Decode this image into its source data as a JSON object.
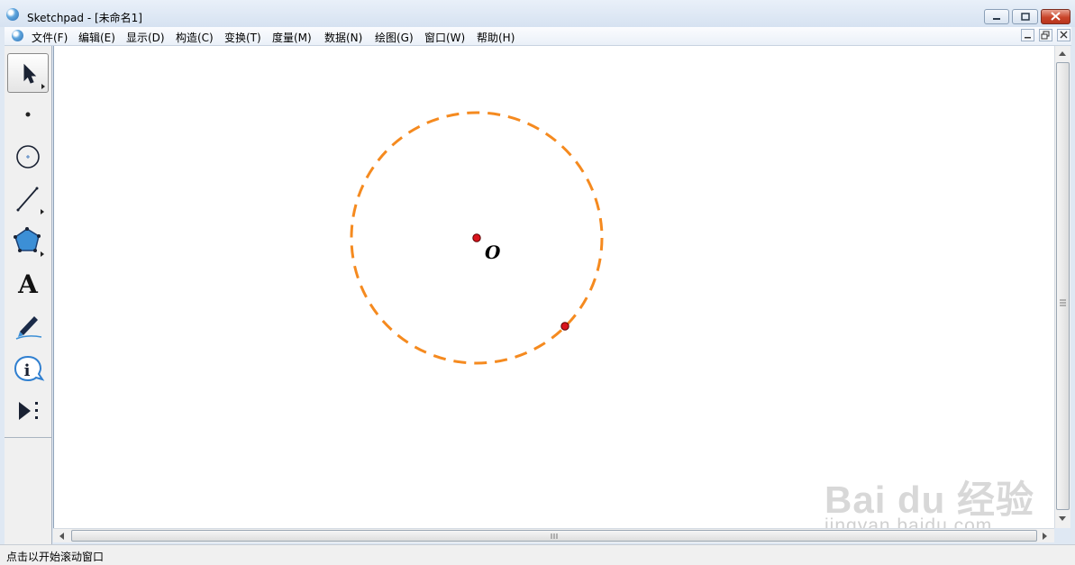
{
  "window": {
    "title": "Sketchpad  - [未命名1]"
  },
  "menu": {
    "items": [
      {
        "label": "文件(F)"
      },
      {
        "label": "编辑(E)"
      },
      {
        "label": "显示(D)"
      },
      {
        "label": "构造(C)"
      },
      {
        "label": "变换(T)"
      },
      {
        "label": "度量(M)"
      },
      {
        "label": "数据(N)"
      },
      {
        "label": "绘图(G)"
      },
      {
        "label": "窗口(W)"
      },
      {
        "label": "帮助(H)"
      }
    ]
  },
  "toolbox": {
    "tools": [
      {
        "icon": "arrow-select-icon",
        "selected": true
      },
      {
        "icon": "point-tool-icon"
      },
      {
        "icon": "compass-tool-icon"
      },
      {
        "icon": "straightedge-tool-icon"
      },
      {
        "icon": "polygon-tool-icon"
      },
      {
        "icon": "text-tool-icon",
        "glyph": "A"
      },
      {
        "icon": "marker-tool-icon"
      },
      {
        "icon": "information-tool-icon",
        "glyph": "i"
      },
      {
        "icon": "custom-tool-icon"
      }
    ]
  },
  "canvas": {
    "circle_style": "dashed",
    "circle_color": "#f58a1f",
    "point_color": "#d9141d",
    "center_label": "O"
  },
  "watermark": {
    "brand": "Bai du 经验",
    "url": "jingyan.baidu.com"
  },
  "status": {
    "text": "点击以开始滚动窗口"
  }
}
